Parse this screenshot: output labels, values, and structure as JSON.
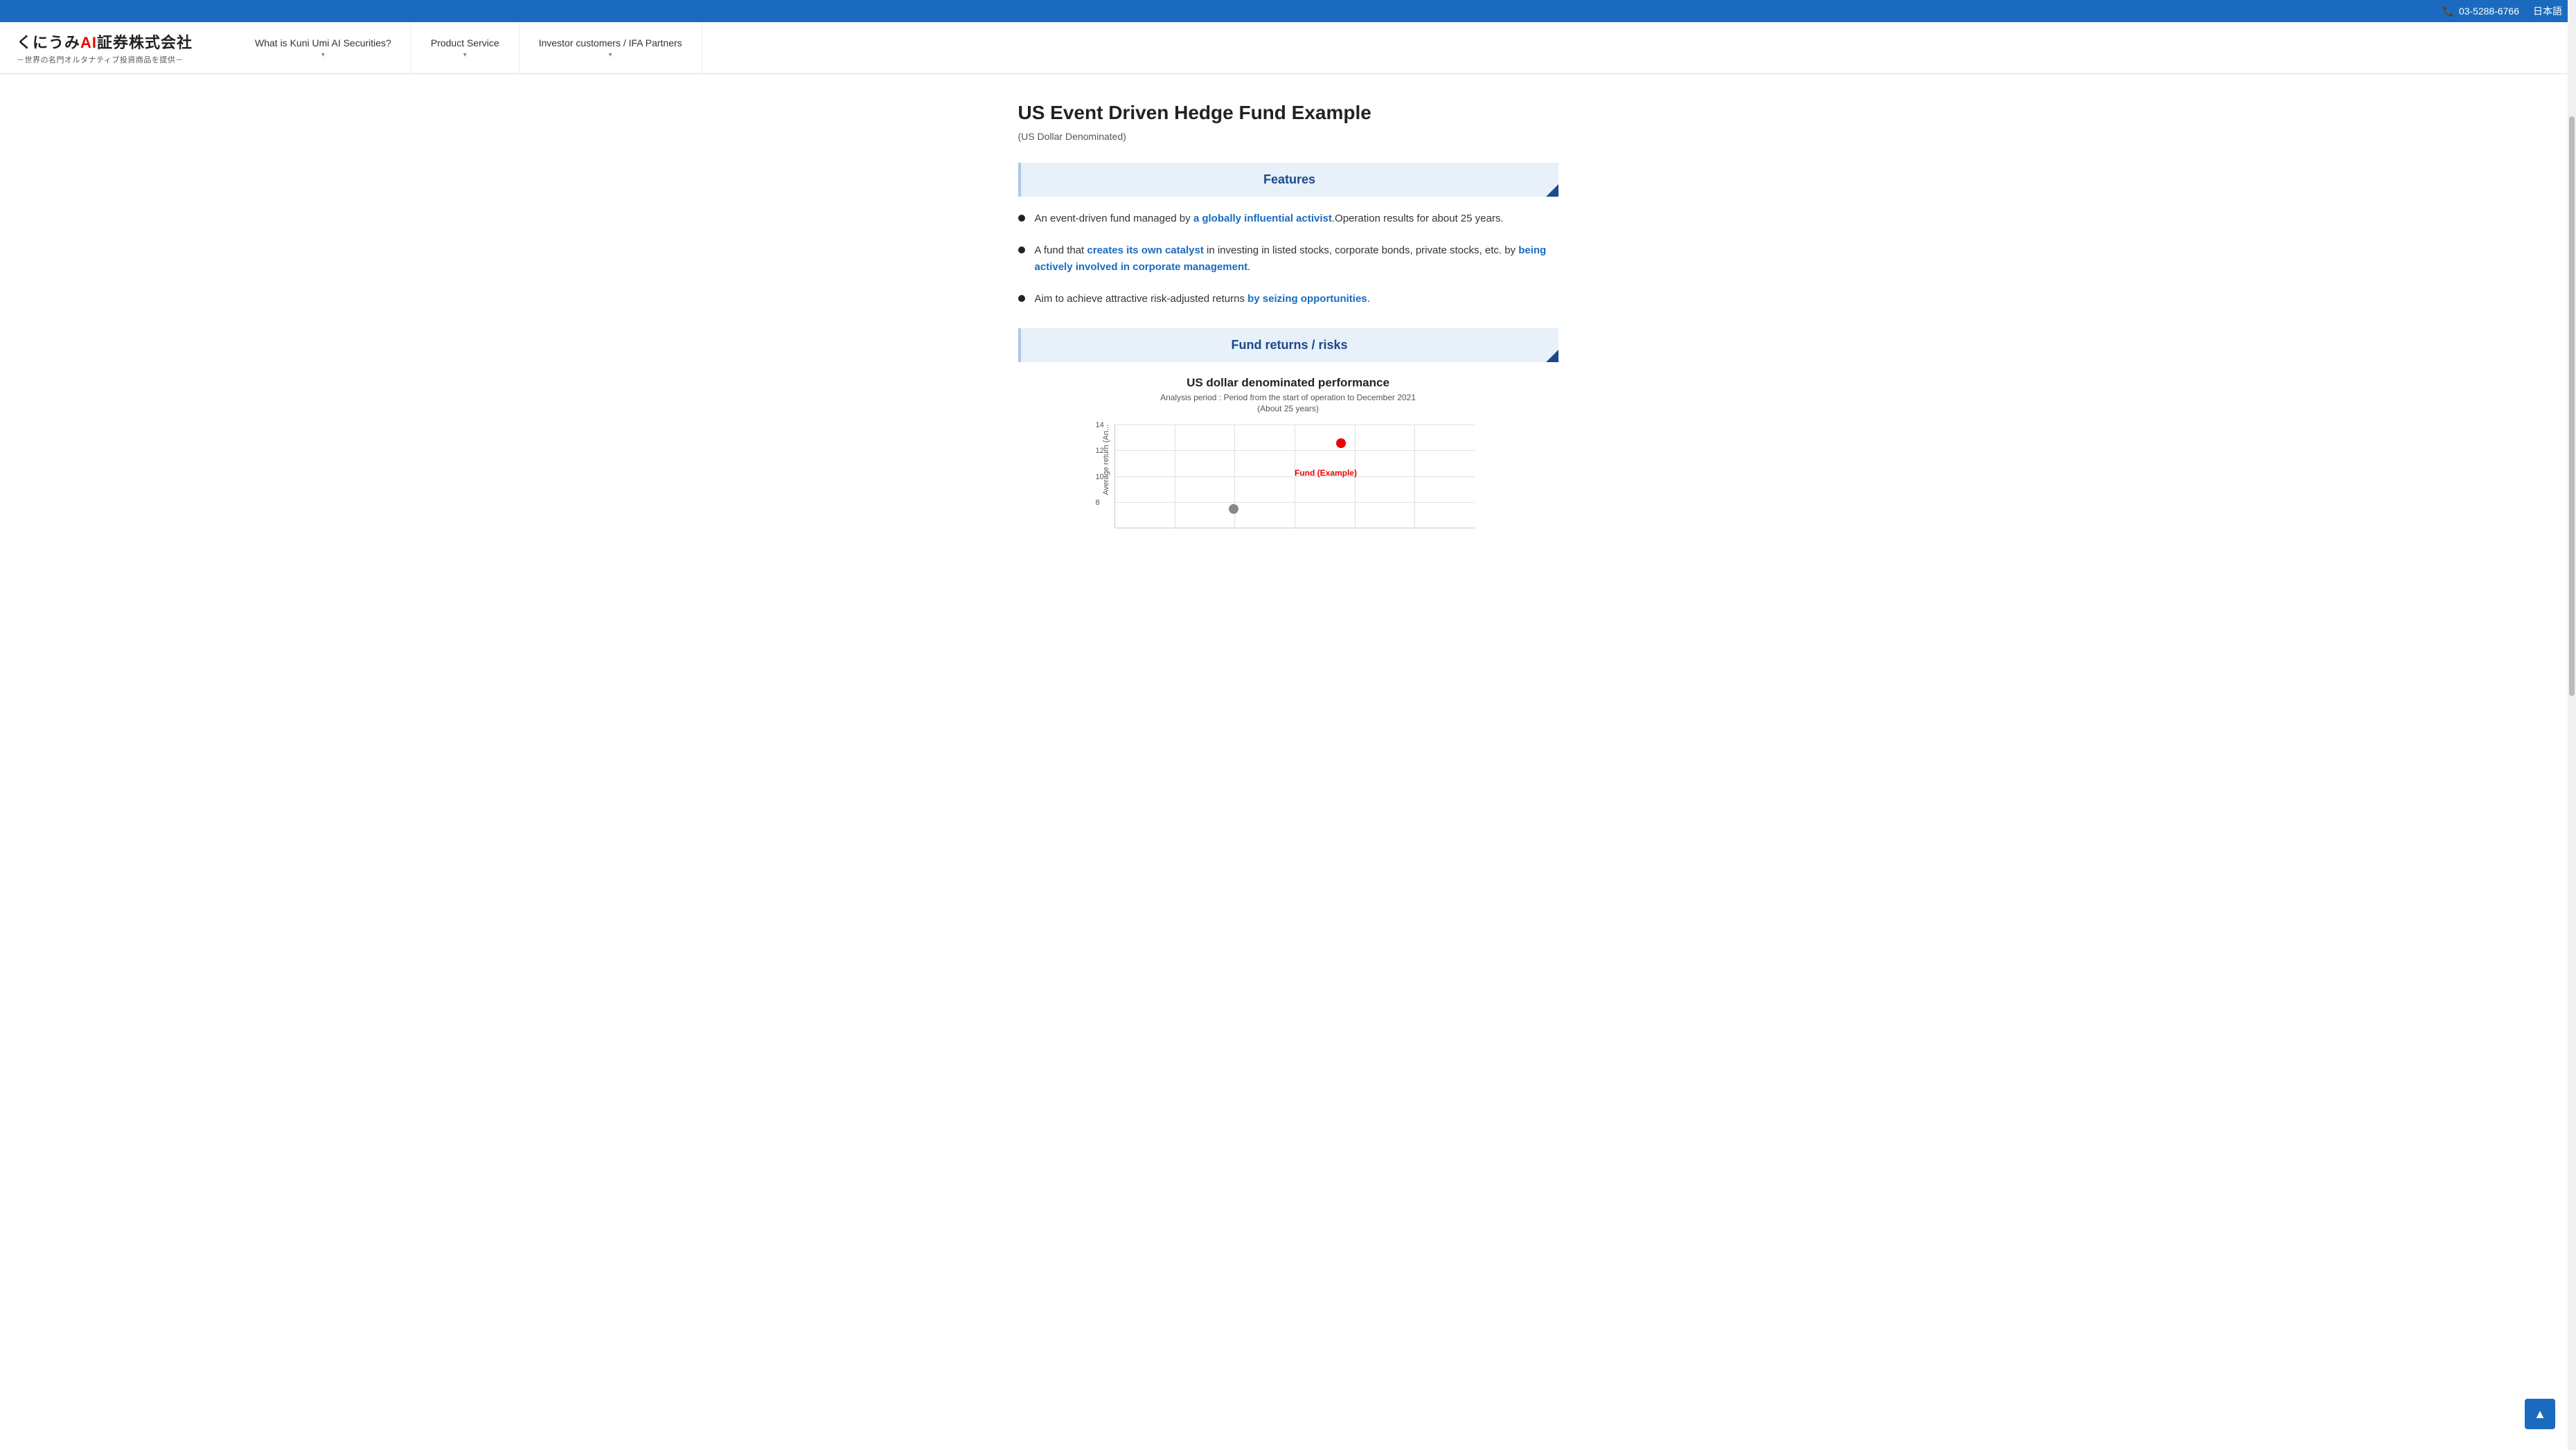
{
  "topbar": {
    "phone": "03-5288-6766",
    "phone_icon": "📞",
    "language": "日本語"
  },
  "logo": {
    "text_part1": "くにうみ",
    "ai_text": "AI",
    "text_part2": "証券株式会社",
    "subtitle": "－世界の名門オルタナティブ投資商品を提供－"
  },
  "nav": {
    "items": [
      {
        "label": "What is Kuni Umi AI Securities?",
        "has_dropdown": true
      },
      {
        "label": "Product Service",
        "has_dropdown": true
      },
      {
        "label": "Investor customers / IFA Partners",
        "has_dropdown": true
      }
    ]
  },
  "page": {
    "title": "US Event Driven Hedge Fund Example",
    "subtitle": "(US Dollar Denominated)"
  },
  "features_section": {
    "heading": "Features",
    "items": [
      {
        "text_before": "An event-driven fund managed by ",
        "link_text": "a globally influential activist",
        "text_after": ".Operation results for about 25 years."
      },
      {
        "text_before": "A fund that ",
        "link_text": "creates its own catalyst",
        "text_middle": " in investing in listed stocks, corporate bonds, private stocks, etc. by ",
        "link_text2": "being actively involved in corporate management",
        "text_after": "."
      },
      {
        "text_before": "Aim to achieve attractive risk-adjusted returns ",
        "link_text": "by seizing opportunities",
        "text_after": "."
      }
    ]
  },
  "fund_returns_section": {
    "heading": "Fund returns / risks"
  },
  "chart": {
    "title": "US dollar denominated performance",
    "subtitle": "Analysis period : Period from the start of operation to December 2021",
    "period": "(About 25 years)",
    "y_axis_label": "Average return (An...",
    "y_values": [
      "14",
      "12",
      "10",
      "8"
    ],
    "dot_red": {
      "label": "Fund (Example)",
      "x_pct": 63,
      "y_pct": 18
    },
    "dot_gray": {
      "x_pct": 33,
      "y_pct": 82
    }
  },
  "scroll_top_btn": {
    "icon": "▲"
  }
}
